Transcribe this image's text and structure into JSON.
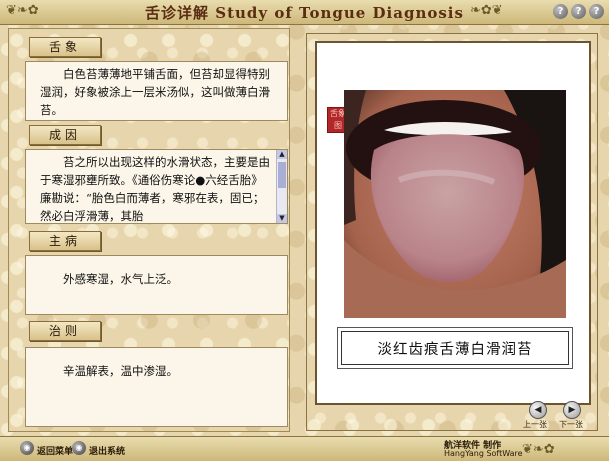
{
  "window": {
    "title": "舌诊详解  Study of Tongue Diagnosis",
    "buttons": [
      "?",
      "?",
      "?"
    ]
  },
  "sections": [
    {
      "heading": "舌象",
      "text": "白色苔薄薄地平铺舌面，但苔却显得特别湿润，好象被涂上一层米汤似，这叫做薄白滑苔。"
    },
    {
      "heading": "成因",
      "text": "苔之所以出现这样的水滑状态，主要是由于寒湿邪壅所致。《通俗伤寒论●六经舌胎》廉勘说：“胎色白而薄者，寒邪在表，固已；然必白浮滑薄，其胎"
    },
    {
      "heading": "主病",
      "text": "外感寒湿，水气上泛。"
    },
    {
      "heading": "治则",
      "text": "辛温解表，温中渗湿。"
    }
  ],
  "image": {
    "seal_text": "舌象图",
    "caption": "淡红齿痕舌薄白滑润苔"
  },
  "nav": {
    "prev_label": "上一张",
    "next_label": "下一张"
  },
  "footer": {
    "menu_label": "返回菜单",
    "exit_label": "退出系统",
    "credit_line1": "航洋软件  制作",
    "credit_line2": "HangYang SoftWare"
  }
}
